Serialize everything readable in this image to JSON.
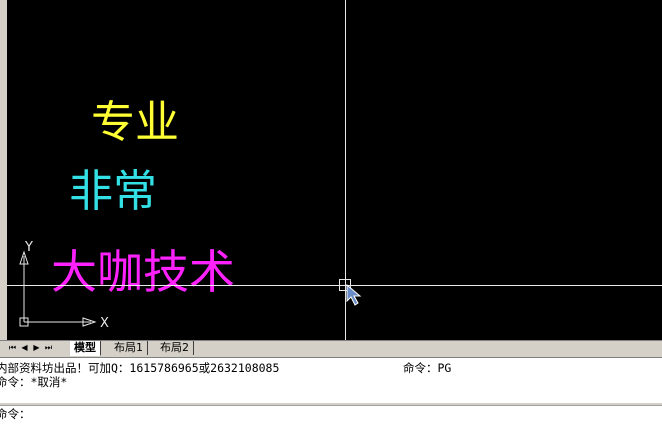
{
  "drawing": {
    "texts": [
      {
        "id": "text1",
        "content": "专业",
        "color": "#ffff33"
      },
      {
        "id": "text2",
        "content": "非常",
        "color": "#33e0e6"
      },
      {
        "id": "text3",
        "content": "大咖技术",
        "color": "#ff22ff"
      }
    ],
    "ucs": {
      "x_label": "X",
      "y_label": "Y"
    }
  },
  "tabs": {
    "nav_icons": [
      "first-tab-icon",
      "prev-tab-icon",
      "next-tab-icon",
      "last-tab-icon"
    ],
    "items": [
      {
        "label": "模型",
        "active": true
      },
      {
        "label": "布局1",
        "active": false
      },
      {
        "label": "布局2",
        "active": false
      }
    ]
  },
  "command": {
    "history": [
      "内部资料坊出品！可加Q：1615786965或2632108085",
      "命令：*取消*"
    ],
    "history_right": "命令：PG",
    "prompt": "命令："
  }
}
